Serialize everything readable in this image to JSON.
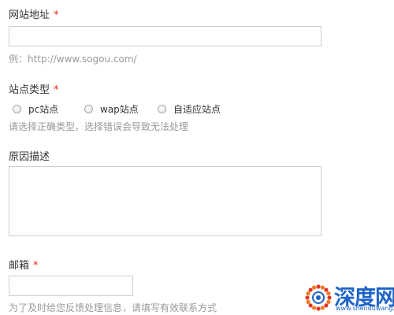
{
  "form": {
    "website": {
      "label": "网站地址",
      "required_mark": "*",
      "value": "",
      "example": "例：http://www.sogou.com/"
    },
    "site_type": {
      "label": "站点类型",
      "required_mark": "*",
      "options": [
        "pc站点",
        "wap站点",
        "自适应站点"
      ],
      "hint": "请选择正确类型，选择错误会导致无法处理"
    },
    "reason": {
      "label": "原因描述",
      "value": ""
    },
    "email": {
      "label": "邮箱",
      "required_mark": "*",
      "value": "",
      "hint": "为了及时给您反馈处理信息，请填写有效联系方式"
    }
  },
  "watermark": {
    "brand": "深度网",
    "url": "www.shenduwang.com"
  },
  "colors": {
    "required": "#e5281a",
    "hint_text": "#999999",
    "input_border": "#cfcfcf",
    "brand_blue": "#1e64c8",
    "brand_orange": "#f07a1e"
  }
}
